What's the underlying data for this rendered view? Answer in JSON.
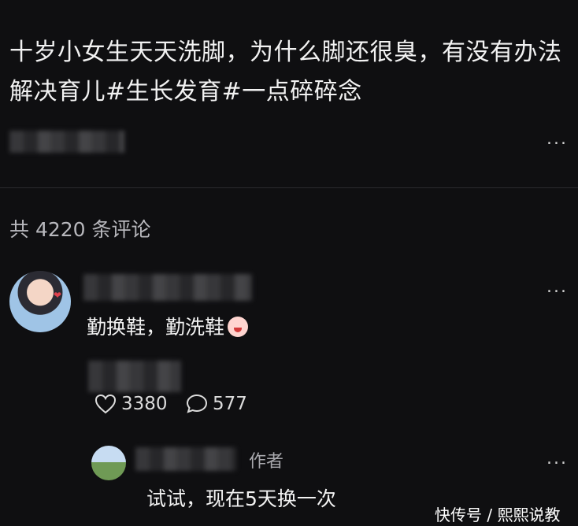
{
  "post": {
    "text": "十岁小女生天天洗脚，为什么脚还很臭，有没有办法解决育儿#生长发育#一点碎碎念"
  },
  "comments_header": {
    "count_text": "共 4220 条评论"
  },
  "comment": {
    "text": "勤换鞋，勤洗鞋",
    "likes": "3380",
    "replies": "577"
  },
  "reply": {
    "author_tag": "作者",
    "text": "试试，现在5天换一次"
  },
  "more_label": "...",
  "watermark": "快传号 / 熙熙说教",
  "colors": {
    "background": "#0f0f11",
    "text": "#f2f2f2",
    "muted": "#b8b8bd"
  }
}
